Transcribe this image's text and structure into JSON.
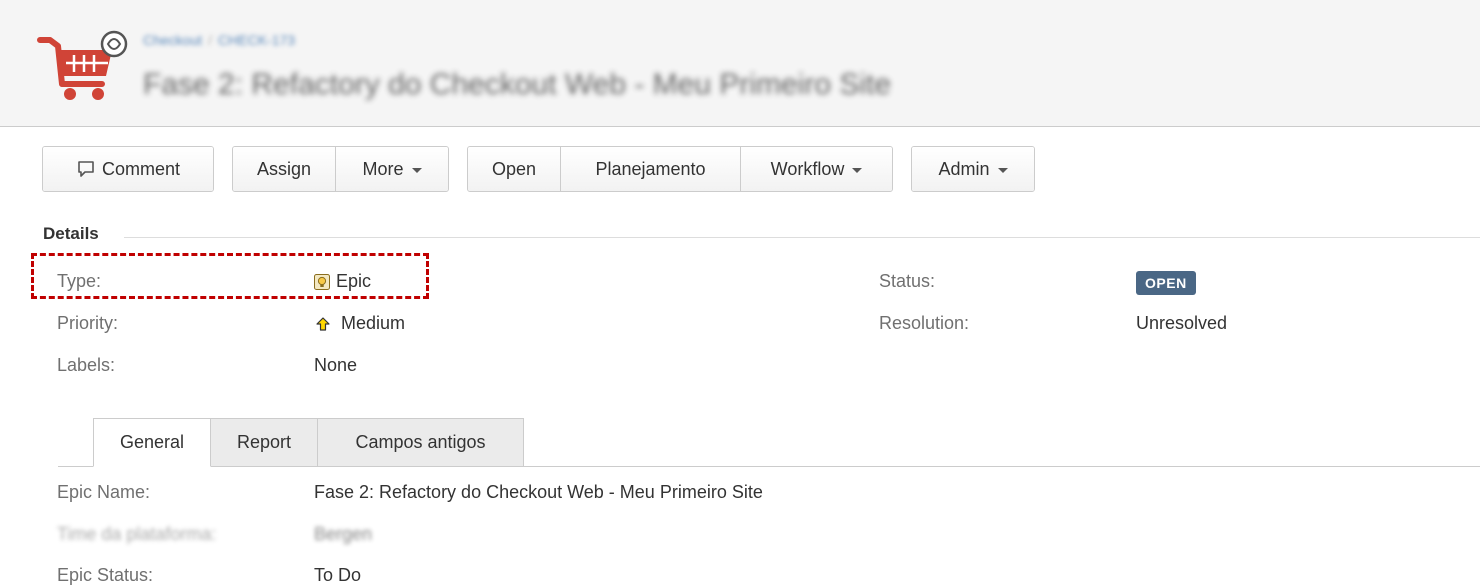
{
  "header": {
    "breadcrumb": [
      "Checkout",
      "CHECK-173"
    ],
    "title": "Fase 2: Refactory do Checkout Web - Meu Primeiro Site",
    "logo_icon": "shopping-cart-icon",
    "logo_color": "#d04437"
  },
  "toolbar": {
    "comment_label": "Comment",
    "assign_label": "Assign",
    "more_label": "More",
    "open_label": "Open",
    "planejamento_label": "Planejamento",
    "workflow_label": "Workflow",
    "admin_label": "Admin"
  },
  "details": {
    "section_title": "Details",
    "type_label": "Type:",
    "type_value": "Epic",
    "priority_label": "Priority:",
    "priority_value": "Medium",
    "labels_label": "Labels:",
    "labels_value": "None",
    "status_label": "Status:",
    "status_value": "OPEN",
    "status_color": "#4a6785",
    "resolution_label": "Resolution:",
    "resolution_value": "Unresolved"
  },
  "tabs": [
    {
      "label": "General",
      "active": true
    },
    {
      "label": "Report",
      "active": false
    },
    {
      "label": "Campos antigos",
      "active": false
    }
  ],
  "general": {
    "epic_name_label": "Epic Name:",
    "epic_name_value": "Fase 2: Refactory do Checkout Web - Meu Primeiro Site",
    "platform_label": "Time da plataforma:",
    "platform_value": "Bergen",
    "epic_status_label": "Epic Status:",
    "epic_status_value": "To Do"
  }
}
